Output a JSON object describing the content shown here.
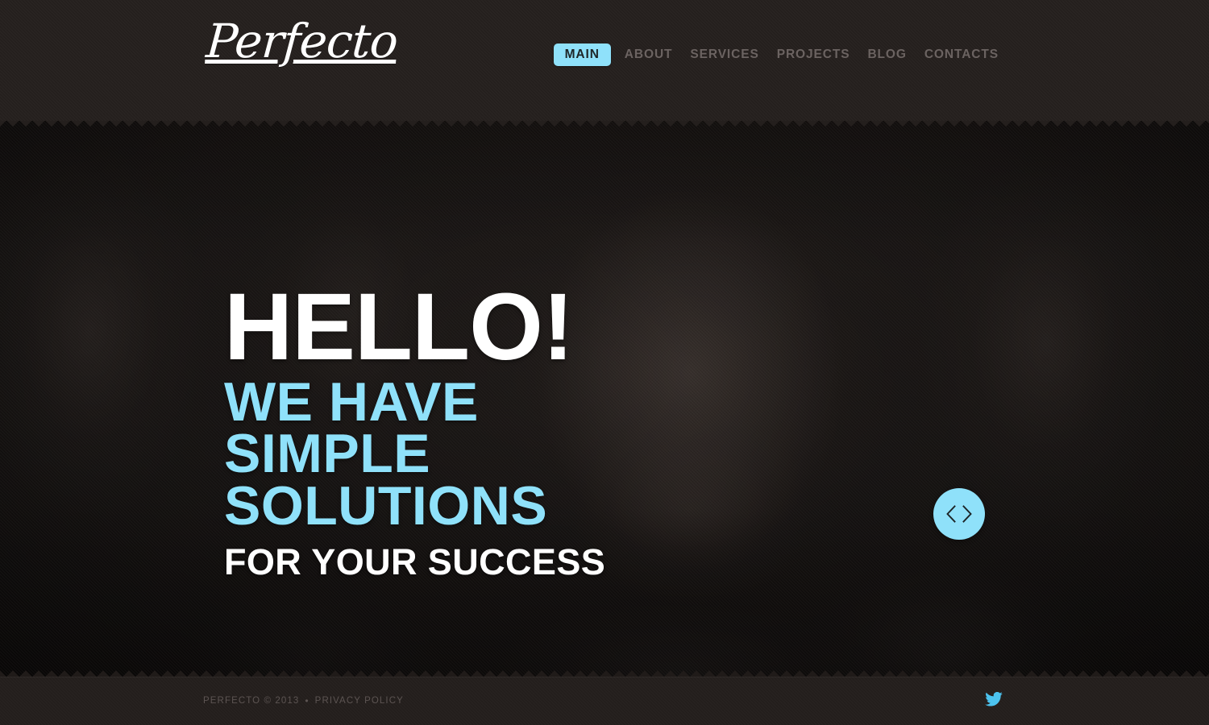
{
  "brand": {
    "logo_text": "Perfecto"
  },
  "nav": {
    "items": [
      {
        "label": "MAIN",
        "active": true
      },
      {
        "label": "ABOUT",
        "active": false
      },
      {
        "label": "SERVICES",
        "active": false
      },
      {
        "label": "PROJECTS",
        "active": false
      },
      {
        "label": "BLOG",
        "active": false
      },
      {
        "label": "CONTACTS",
        "active": false
      }
    ]
  },
  "hero": {
    "line1": "HELLO!",
    "line2": "WE HAVE SIMPLE SOLUTIONS",
    "line3": "FOR YOUR SUCCESS",
    "slider": {
      "prev_icon": "chevron-left-icon",
      "prev_glyph": "‹",
      "next_icon": "chevron-right-icon",
      "next_glyph": "›"
    }
  },
  "footer": {
    "copyright_text": "PERFECTO © 2013",
    "separator": "•",
    "privacy_label": "PRIVACY POLICY",
    "social": [
      {
        "name": "twitter-icon",
        "label": "Twitter"
      }
    ]
  },
  "colors": {
    "accent": "#8fe1fa",
    "header_bg": "#241f1d",
    "footer_bg": "#231e1c",
    "nav_text": "#6b6361",
    "footer_text": "#5c5452",
    "hero_heading": "#ffffff"
  }
}
